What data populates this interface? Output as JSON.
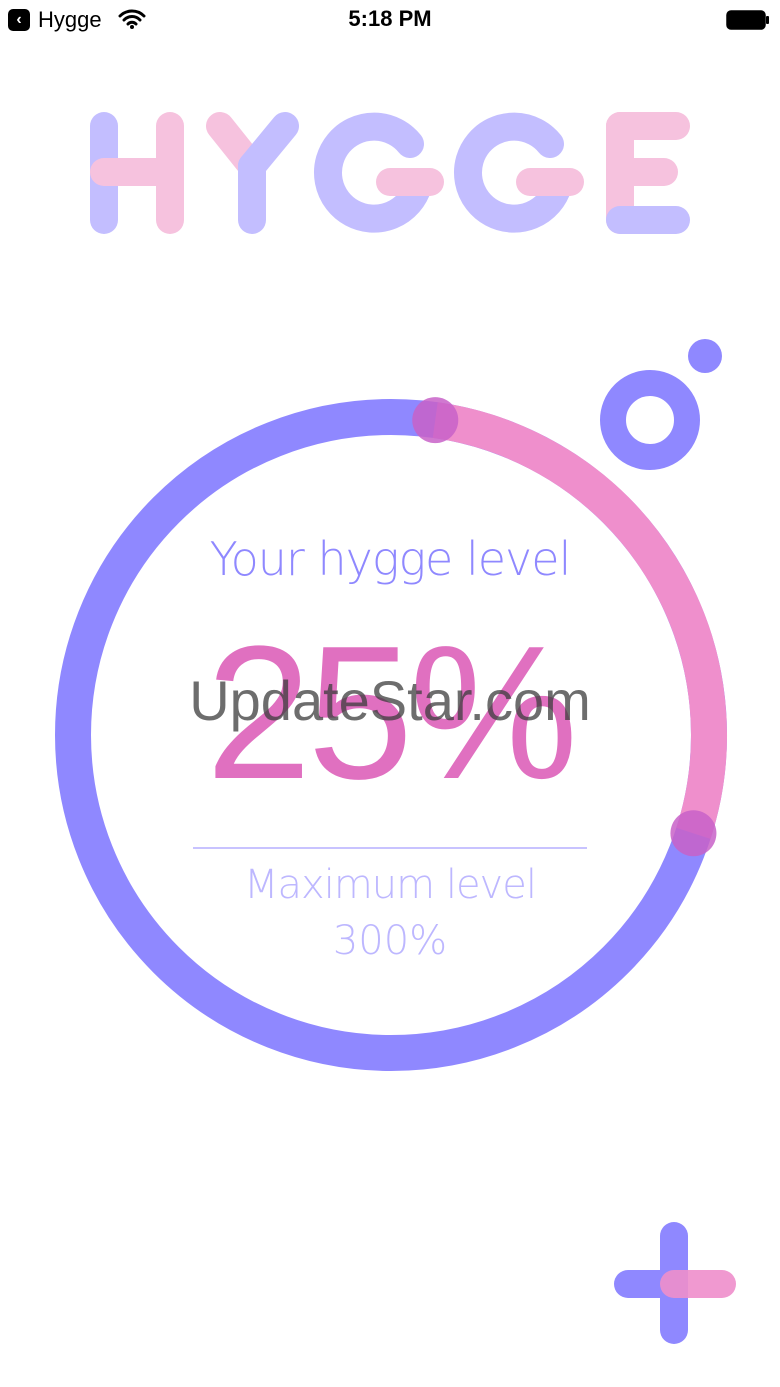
{
  "status_bar": {
    "back_app_label": "Hygge",
    "time": "5:18 PM"
  },
  "logo": {
    "text": "HYGGE",
    "colors": {
      "blue": "#b9b3ff",
      "pink": "#f5b8d9"
    }
  },
  "gauge": {
    "caption": "Your hygge level",
    "value": "25%",
    "max_label": "Maximum level",
    "max_value": "300%",
    "level_percent": 25,
    "max_percent": 300,
    "colors": {
      "track": "#8f88ff",
      "progress": "#ef8fcc",
      "knob": "#c861c8"
    }
  },
  "watermark": "UpdateStar.com",
  "icons": {
    "back": "back-chevron-icon",
    "wifi": "wifi-icon",
    "battery": "battery-icon",
    "ring": "ring-decoration-icon",
    "add": "plus-icon"
  }
}
